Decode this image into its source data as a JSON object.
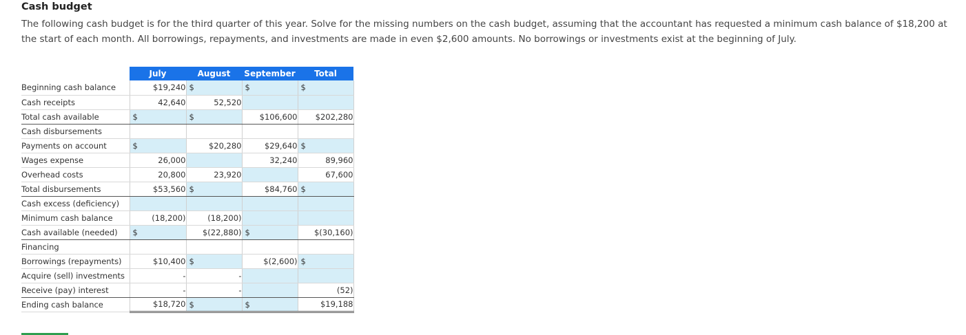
{
  "header": {
    "title": "Cash budget",
    "intro": "The following cash budget is for the third quarter of this year. Solve for the missing numbers on the cash budget, assuming that the accountant has requested a minimum cash balance of $18,200 at the start of each month. All borrowings, repayments, and investments are made in even $2,600 amounts. No borrowings or investments exist at the beginning of July."
  },
  "table": {
    "columns": [
      "July",
      "August",
      "September",
      "Total"
    ],
    "rows": [
      {
        "label": "Beginning cash balance",
        "cells": [
          {
            "v": "$19,240",
            "d": "",
            "in": false
          },
          {
            "v": "",
            "d": "$",
            "in": true
          },
          {
            "v": "",
            "d": "$",
            "in": true
          },
          {
            "v": "",
            "d": "$",
            "in": true
          }
        ]
      },
      {
        "label": "Cash receipts",
        "cells": [
          {
            "v": "42,640",
            "d": "",
            "in": false
          },
          {
            "v": "52,520",
            "d": "",
            "in": false
          },
          {
            "v": "",
            "d": "",
            "in": true
          },
          {
            "v": "",
            "d": "",
            "in": true
          }
        ]
      },
      {
        "label": "Total cash available",
        "cells": [
          {
            "v": "",
            "d": "$",
            "in": true
          },
          {
            "v": "",
            "d": "$",
            "in": true
          },
          {
            "v": "$106,600",
            "d": "",
            "in": false
          },
          {
            "v": "$202,280",
            "d": "",
            "in": false
          }
        ]
      },
      {
        "label": "Cash disbursements",
        "cells": [
          {
            "v": "",
            "d": "",
            "in": false
          },
          {
            "v": "",
            "d": "",
            "in": false
          },
          {
            "v": "",
            "d": "",
            "in": false
          },
          {
            "v": "",
            "d": "",
            "in": false
          }
        ]
      },
      {
        "label": "Payments on account",
        "cells": [
          {
            "v": "",
            "d": "$",
            "in": true
          },
          {
            "v": "$20,280",
            "d": "",
            "in": false
          },
          {
            "v": "$29,640",
            "d": "",
            "in": false
          },
          {
            "v": "",
            "d": "$",
            "in": true
          }
        ]
      },
      {
        "label": "Wages expense",
        "cells": [
          {
            "v": "26,000",
            "d": "",
            "in": false
          },
          {
            "v": "",
            "d": "",
            "in": true
          },
          {
            "v": "32,240",
            "d": "",
            "in": false
          },
          {
            "v": "89,960",
            "d": "",
            "in": false
          }
        ]
      },
      {
        "label": "Overhead costs",
        "cells": [
          {
            "v": "20,800",
            "d": "",
            "in": false
          },
          {
            "v": "23,920",
            "d": "",
            "in": false
          },
          {
            "v": "",
            "d": "",
            "in": true
          },
          {
            "v": "67,600",
            "d": "",
            "in": false
          }
        ]
      },
      {
        "label": "Total disbursements",
        "cells": [
          {
            "v": "$53,560",
            "d": "",
            "in": false
          },
          {
            "v": "",
            "d": "$",
            "in": true
          },
          {
            "v": "$84,760",
            "d": "",
            "in": false
          },
          {
            "v": "",
            "d": "$",
            "in": true
          }
        ]
      },
      {
        "label": "Cash excess (deficiency)",
        "cells": [
          {
            "v": "",
            "d": "",
            "in": true
          },
          {
            "v": "",
            "d": "",
            "in": true
          },
          {
            "v": "",
            "d": "",
            "in": true
          },
          {
            "v": "",
            "d": "",
            "in": true
          }
        ]
      },
      {
        "label": "Minimum cash balance",
        "cells": [
          {
            "v": "(18,200)",
            "d": "",
            "in": false
          },
          {
            "v": "(18,200)",
            "d": "",
            "in": false
          },
          {
            "v": "",
            "d": "",
            "in": true
          },
          {
            "v": "",
            "d": "",
            "in": true
          }
        ]
      },
      {
        "label": "Cash available (needed)",
        "cells": [
          {
            "v": "",
            "d": "$",
            "in": true
          },
          {
            "v": "$(22,880)",
            "d": "",
            "in": false
          },
          {
            "v": "",
            "d": "$",
            "in": true
          },
          {
            "v": "$(30,160)",
            "d": "",
            "in": false
          }
        ]
      },
      {
        "label": "Financing",
        "cells": [
          {
            "v": "",
            "d": "",
            "in": false
          },
          {
            "v": "",
            "d": "",
            "in": false
          },
          {
            "v": "",
            "d": "",
            "in": false
          },
          {
            "v": "",
            "d": "",
            "in": false
          }
        ]
      },
      {
        "label": "Borrowings (repayments)",
        "cells": [
          {
            "v": "$10,400",
            "d": "",
            "in": false
          },
          {
            "v": "",
            "d": "$",
            "in": true
          },
          {
            "v": "$(2,600)",
            "d": "",
            "in": false
          },
          {
            "v": "",
            "d": "$",
            "in": true
          }
        ]
      },
      {
        "label": "Acquire (sell) investments",
        "cells": [
          {
            "v": "-",
            "d": "",
            "in": false
          },
          {
            "v": "-",
            "d": "",
            "in": false
          },
          {
            "v": "",
            "d": "",
            "in": true
          },
          {
            "v": "",
            "d": "",
            "in": true
          }
        ]
      },
      {
        "label": "Receive (pay) interest",
        "cells": [
          {
            "v": "-",
            "d": "",
            "in": false
          },
          {
            "v": "-",
            "d": "",
            "in": false
          },
          {
            "v": "",
            "d": "",
            "in": true
          },
          {
            "v": "(52)",
            "d": "",
            "in": false
          }
        ]
      },
      {
        "label": "Ending cash balance",
        "cells": [
          {
            "v": "$18,720",
            "d": "",
            "in": false
          },
          {
            "v": "",
            "d": "$",
            "in": true
          },
          {
            "v": "",
            "d": "$",
            "in": true
          },
          {
            "v": "$19,188",
            "d": "",
            "in": false
          }
        ]
      }
    ]
  },
  "colors": {
    "header": "#1a73e8",
    "input": "#d6eef8"
  }
}
